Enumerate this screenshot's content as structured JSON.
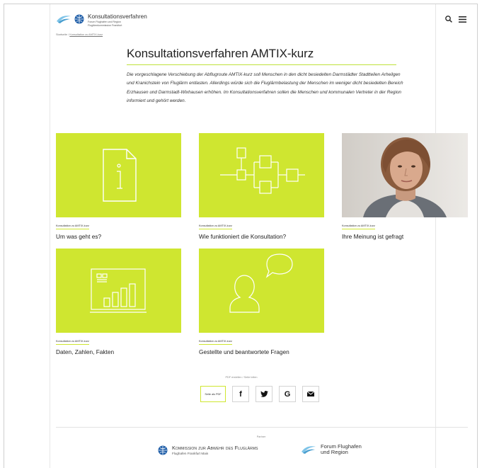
{
  "header": {
    "logo_title": "Konsultationsverfahren",
    "logo_sub_line1": "Forum Flughafen und Region",
    "logo_sub_line2": "Fluglärmkommission Frankfurt",
    "search_icon": "search-icon",
    "menu_icon": "hamburger-menu-icon"
  },
  "breadcrumb": {
    "home": "Startseite",
    "separator": "/",
    "current": "Konsultation zu AMTIX-kurz"
  },
  "page": {
    "title": "Konsultationsverfahren AMTIX-kurz",
    "intro": "Die vorgeschlagene Verschiebung der Abflugroute AMTIX-kurz soll Menschen in den dicht besiedelten Darmstädter Stadtteilen Arheilgen und Kranichstein von Fluglärm entlasten. Allerdings würde sich die Fluglärmbelastung der Menschen im weniger dicht besiedelten Bereich Erzhausen und Darmstadt-Wixhausen erhöhen. Im Konsultationsverfahren sollen die Menschen und kommunalen Vertreter in der Region informiert und gehört werden."
  },
  "cards": [
    {
      "kicker": "Konsultation zu AMTIX-kurz",
      "title": "Um was geht es?",
      "icon": "document-info-icon"
    },
    {
      "kicker": "Konsultation zu AMTIX-kurz",
      "title": "Wie funktioniert die Konsultation?",
      "icon": "flowchart-icon"
    },
    {
      "kicker": "Konsultation zu AMTIX-kurz",
      "title": "Ihre Meinung ist gefragt",
      "icon": "woman-photo"
    },
    {
      "kicker": "Konsultation zu AMTIX-kurz",
      "title": "Daten, Zahlen, Fakten",
      "icon": "bar-chart-icon"
    },
    {
      "kicker": "Konsultation zu AMTIX-kurz",
      "title": "Gestellte und beantwortete Fragen",
      "icon": "person-speech-bubble-icon"
    }
  ],
  "share": {
    "label": "PDF erstellen / Seite teilen",
    "pdf_button": "Seite als PDF",
    "facebook": "f",
    "google": "G"
  },
  "footer": {
    "partner_label": "Partner",
    "partner1_title": "Kommission zur Abwehr des Fluglärms",
    "partner1_sub": "Flughafen Frankfurt Main",
    "partner2_title_line1": "Forum Flughafen",
    "partner2_title_line2": "und Region"
  },
  "colors": {
    "accent": "#cfe630",
    "text": "#222222"
  }
}
